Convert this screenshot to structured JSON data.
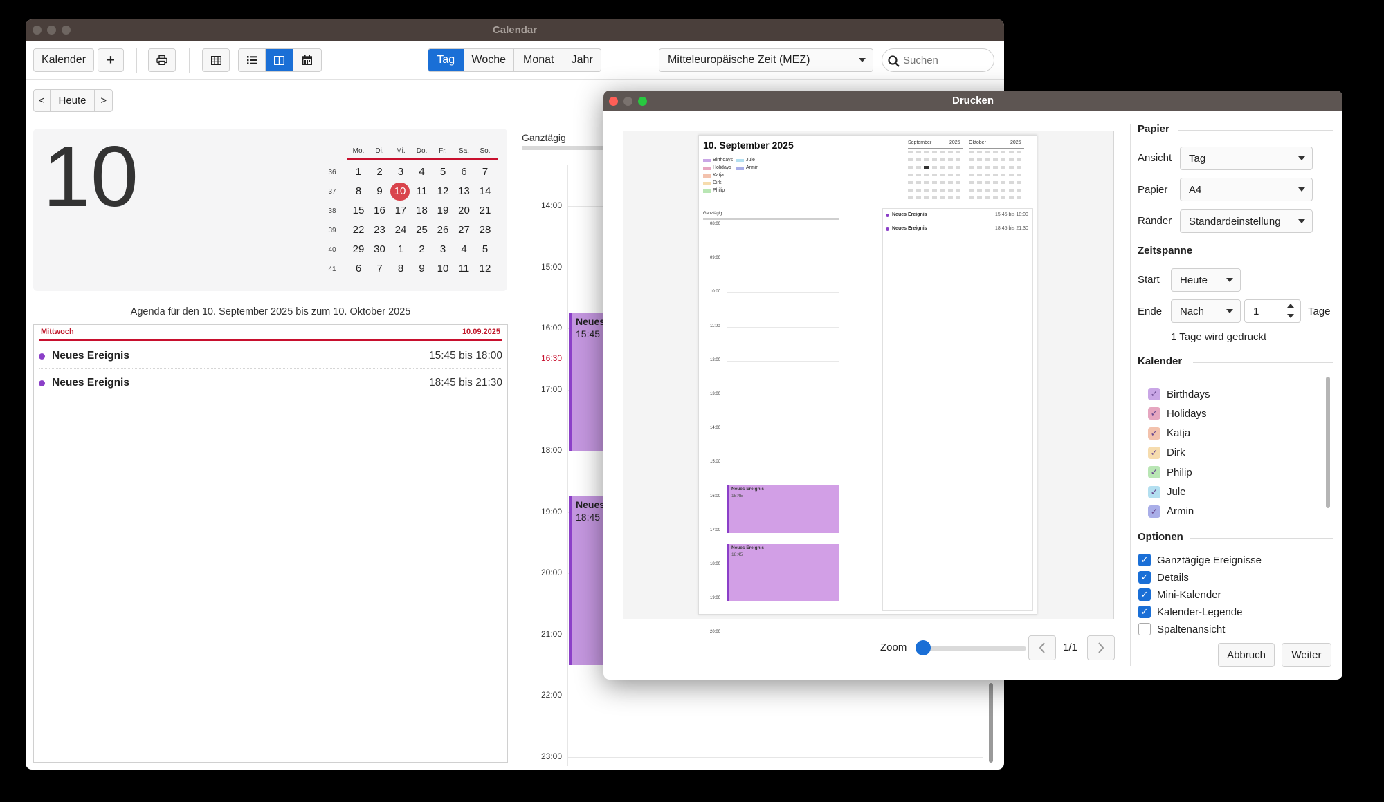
{
  "main": {
    "title": "Calendar",
    "toolbar": {
      "calendar_label": "Kalender",
      "add_icon": "+",
      "views": [
        "Tag",
        "Woche",
        "Monat",
        "Jahr"
      ],
      "active_view": "Tag",
      "timezone": "Mitteleuropäische Zeit (MEZ)",
      "search_placeholder": "Suchen"
    },
    "nav": {
      "prev": "<",
      "today": "Heute",
      "next": ">"
    },
    "big_day": "10",
    "mini_calendar": {
      "weekdays": [
        "Mo.",
        "Di.",
        "Mi.",
        "Do.",
        "Fr.",
        "Sa.",
        "So."
      ],
      "weeks": [
        {
          "num": "36",
          "days": [
            "1",
            "2",
            "3",
            "4",
            "5",
            "6",
            "7"
          ]
        },
        {
          "num": "37",
          "days": [
            "8",
            "9",
            "10",
            "11",
            "12",
            "13",
            "14"
          ]
        },
        {
          "num": "38",
          "days": [
            "15",
            "16",
            "17",
            "18",
            "19",
            "20",
            "21"
          ]
        },
        {
          "num": "39",
          "days": [
            "22",
            "23",
            "24",
            "25",
            "26",
            "27",
            "28"
          ]
        },
        {
          "num": "40",
          "days": [
            "29",
            "30",
            "1",
            "2",
            "3",
            "4",
            "5"
          ]
        },
        {
          "num": "41",
          "days": [
            "6",
            "7",
            "8",
            "9",
            "10",
            "11",
            "12"
          ]
        }
      ],
      "selected": "10"
    },
    "agenda": {
      "title": "Agenda für den 10. September 2025 bis zum 10. Oktober 2025",
      "day_name": "Mittwoch",
      "date": "10.09.2025",
      "events": [
        {
          "name": "Neues Ereignis",
          "time": "15:45 bis 18:00"
        },
        {
          "name": "Neues Ereignis",
          "time": "18:45 bis 21:30"
        }
      ]
    },
    "day_view": {
      "allday_label": "Ganztägig",
      "hours": [
        "14:00",
        "15:00",
        "16:00",
        "17:00",
        "18:00",
        "19:00",
        "20:00",
        "21:00",
        "22:00",
        "23:00"
      ],
      "now_label": "16:30",
      "events": [
        {
          "name": "Neues",
          "time": "15:45"
        },
        {
          "name": "Neues",
          "time": "18:45"
        }
      ]
    }
  },
  "dialog": {
    "title": "Drucken",
    "papier_section": "Papier",
    "ansicht_label": "Ansicht",
    "ansicht_value": "Tag",
    "papier_label": "Papier",
    "papier_value": "A4",
    "raender_label": "Ränder",
    "raender_value": "Standardeinstellung",
    "zeitspanne_section": "Zeitspanne",
    "start_label": "Start",
    "start_value": "Heute",
    "ende_label": "Ende",
    "ende_value": "Nach",
    "ende_count": "1",
    "tage_label": "Tage",
    "printed_note": "1 Tage wird gedruckt",
    "kalender_section": "Kalender",
    "calendars": [
      {
        "name": "Birthdays",
        "color": "#c9a6e6"
      },
      {
        "name": "Holidays",
        "color": "#e6a6c0"
      },
      {
        "name": "Katja",
        "color": "#f3c2ad"
      },
      {
        "name": "Dirk",
        "color": "#f6dcae"
      },
      {
        "name": "Philip",
        "color": "#b9e6b4"
      },
      {
        "name": "Jule",
        "color": "#b3dff0"
      },
      {
        "name": "Armin",
        "color": "#a9aee8"
      }
    ],
    "optionen_section": "Optionen",
    "options": [
      {
        "name": "Ganztägige Ereignisse",
        "checked": true
      },
      {
        "name": "Details",
        "checked": true
      },
      {
        "name": "Mini-Kalender",
        "checked": true
      },
      {
        "name": "Kalender-Legende",
        "checked": true
      },
      {
        "name": "Spaltenansicht",
        "checked": false
      }
    ],
    "zoom_label": "Zoom",
    "zoom_value": 0,
    "page_indicator": "1/1",
    "cancel": "Abbruch",
    "next": "Weiter",
    "preview": {
      "title": "10. September 2025",
      "legend": [
        "Birthdays",
        "Holidays",
        "Katja",
        "Dirk",
        "Philip",
        "Jule",
        "Armin"
      ],
      "month1": "September",
      "year1": "2025",
      "month2": "Oktober",
      "year2": "2025",
      "allday": "Ganztägig",
      "hours": [
        "08:00",
        "09:00",
        "10:00",
        "11:00",
        "12:00",
        "13:00",
        "14:00",
        "15:00",
        "16:00",
        "17:00",
        "18:00",
        "19:00",
        "20:00"
      ],
      "events": [
        {
          "name": "Neues Ereignis",
          "time": "15:45 bis 18:00",
          "start": "15:45"
        },
        {
          "name": "Neues Ereignis",
          "time": "18:45 bis 21:30",
          "start": "18:45"
        }
      ]
    }
  }
}
